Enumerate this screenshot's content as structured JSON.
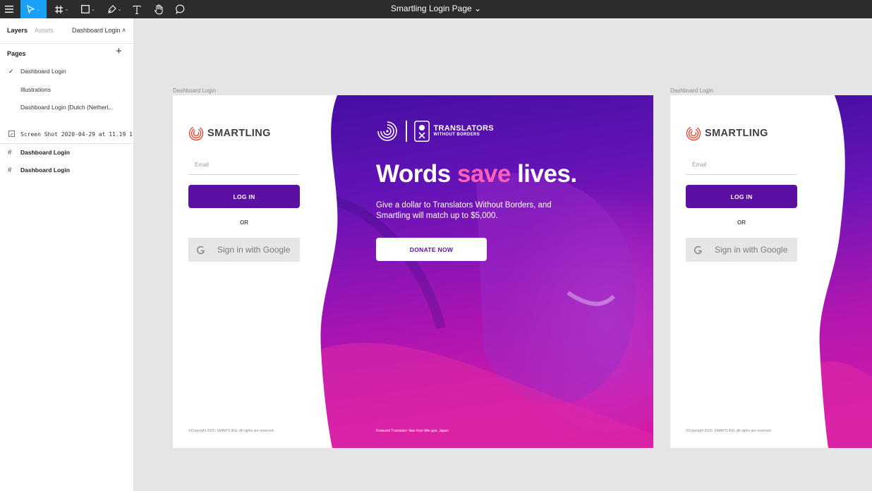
{
  "toolbar": {
    "title": "Smartling Login Page",
    "title_caret": "⌄"
  },
  "sidebar": {
    "tabs": {
      "layers": "Layers",
      "assets": "Assets"
    },
    "page_dropdown": "Dashboard Login ˄",
    "pages_header": "Pages",
    "add_page": "+",
    "pages": [
      {
        "label": "Dashboard Login",
        "checked": true
      },
      {
        "label": "Illustrations"
      },
      {
        "label": "Dashboard Login [Dutch (Netherl..."
      }
    ],
    "layers": [
      {
        "label": "Screen Shot 2020-04-29 at 11.19 1",
        "icon": "image-icon"
      },
      {
        "label": "Dashboard Login",
        "icon": "frame-icon"
      },
      {
        "label": "Dashboard Login",
        "icon": "frame-icon"
      }
    ]
  },
  "canvas": {
    "frames": [
      {
        "label": "Dashboard Login",
        "logo_text": "SMARTLING",
        "email_placeholder": "Email",
        "login_label": "LOG IN",
        "or_label": "OR",
        "google_label": "Sign in with Google",
        "copyright": "©Copyright 2020. SMARTLING. All rights are reserved.",
        "twb_name": "TRANSLATORS",
        "twb_sub": "WITHOUT BORDERS",
        "headline": {
          "a": "Words ",
          "b": "save",
          "c": " lives."
        },
        "subtext": "Give a dollar to Translators Without Borders, and Smartling will match up to $5,000.",
        "donate_label": "DONATE NOW",
        "credit": "Featured Translator: Nao from Mie-gun, Japan"
      },
      {
        "label": "Dashboard Login",
        "logo_text": "SMARTLING",
        "email_placeholder": "Email",
        "login_label": "LOG IN",
        "or_label": "OR",
        "google_label": "Sign in with Google",
        "copyright": "©Copyright 2020. SMARTLING. All rights are reserved."
      }
    ]
  },
  "colors": {
    "toolbar_bg": "#2c2c2c",
    "tool_active": "#18a0fb",
    "brand_purple": "#5b0fa3",
    "headline_accent": "#ff5fb8",
    "smartling_red": "#e8452f"
  }
}
